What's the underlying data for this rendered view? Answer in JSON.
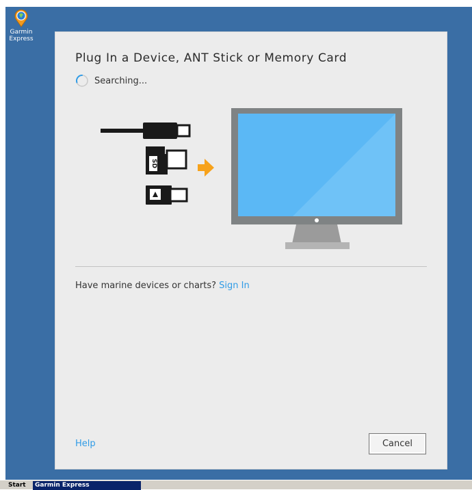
{
  "desktop": {
    "icons": [
      {
        "label": "Garmin Express",
        "icon": "garmin-express-icon"
      }
    ]
  },
  "dialog": {
    "title": "Plug In a Device, ANT Stick or Memory Card",
    "status_text": "Searching...",
    "sd_label": "SD",
    "marine_prompt": "Have marine devices or charts?",
    "sign_in_label": "Sign In",
    "help_label": "Help",
    "cancel_label": "Cancel"
  },
  "taskbar": {
    "start_label": "Start",
    "items": [
      {
        "label": "Garmin Express"
      }
    ]
  },
  "colors": {
    "desktop_bg": "#3a6ea5",
    "dialog_bg": "#ececec",
    "link": "#2f9be6",
    "arrow": "#f7a21b",
    "screen": "#5bb8f5",
    "monitor_frame": "#7f8384"
  }
}
